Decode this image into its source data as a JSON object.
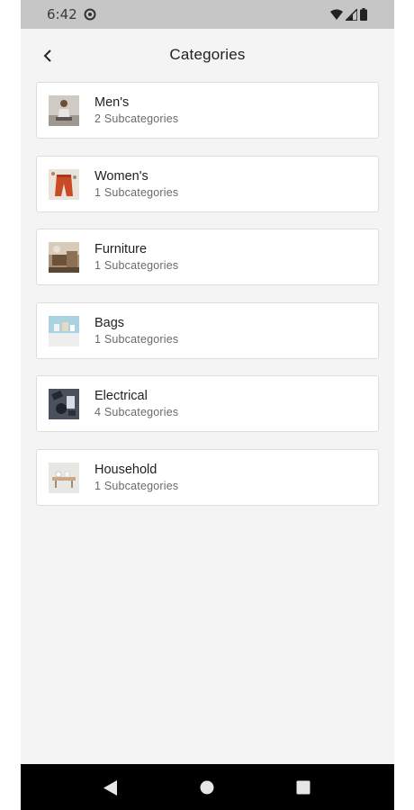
{
  "status_bar": {
    "time": "6:42",
    "icons": [
      "app-notification-icon",
      "wifi-icon",
      "signal-icon",
      "battery-icon"
    ]
  },
  "header": {
    "title": "Categories",
    "back_icon": "chevron-left-icon"
  },
  "categories": [
    {
      "name": "Men's",
      "subcategories": "2 Subcategories",
      "thumb_color": "#b9b4ae"
    },
    {
      "name": "Women's",
      "subcategories": "1 Subcategories",
      "thumb_color": "#c9522d"
    },
    {
      "name": "Furniture",
      "subcategories": "1 Subcategories",
      "thumb_color": "#8d7458"
    },
    {
      "name": "Bags",
      "subcategories": "1 Subcategories",
      "thumb_color": "#a9d3e0"
    },
    {
      "name": "Electrical",
      "subcategories": "4 Subcategories",
      "thumb_color": "#3f4655"
    },
    {
      "name": "Household",
      "subcategories": "1 Subcategories",
      "thumb_color": "#d9d6d2"
    }
  ],
  "nav_bar": {
    "buttons": [
      "back-triangle-icon",
      "home-circle-icon",
      "recents-square-icon"
    ]
  },
  "colors": {
    "background": "#f4f4f4",
    "card": "#ffffff",
    "status_bar": "#c6c6c6",
    "nav_bar": "#000000"
  }
}
